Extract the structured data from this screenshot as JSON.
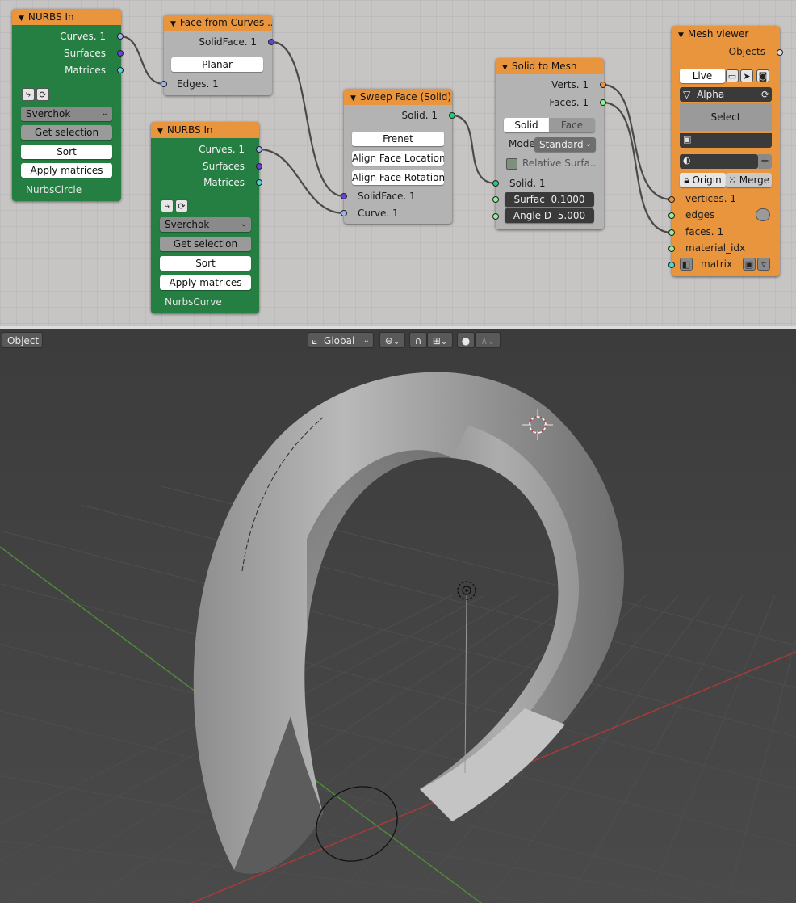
{
  "node_editor": {
    "nurbs_in_1": {
      "title": "NURBS In",
      "outputs": [
        "Curves. 1",
        "Surfaces",
        "Matrices"
      ],
      "implementation": "Sverchok",
      "get_selection_label": "Get selection",
      "sort_label": "Sort",
      "apply_matrices_label": "Apply matrices",
      "object_name": "NurbsCircle"
    },
    "face_from_curves": {
      "title": "Face from Curves ..",
      "output": "SolidFace. 1",
      "mode_button": "Planar",
      "input": "Edges. 1"
    },
    "nurbs_in_2": {
      "title": "NURBS In",
      "outputs": [
        "Curves. 1",
        "Surfaces",
        "Matrices"
      ],
      "implementation": "Sverchok",
      "get_selection_label": "Get selection",
      "sort_label": "Sort",
      "apply_matrices_label": "Apply matrices",
      "object_name": "NurbsCurve"
    },
    "sweep_face": {
      "title": "Sweep Face (Solid)",
      "output": "Solid. 1",
      "buttons": [
        "Frenet",
        "Align Face Location",
        "Align Face Rotation"
      ],
      "inputs": [
        "SolidFace. 1",
        "Curve. 1"
      ]
    },
    "solid_to_mesh": {
      "title": "Solid to Mesh",
      "outputs": [
        "Verts. 1",
        "Faces. 1"
      ],
      "tabs": [
        "Solid",
        "Face"
      ],
      "mode_label": "Mode",
      "mode_value": "Standard",
      "relative_label": "Relative Surfa..",
      "input_solid": "Solid. 1",
      "surface_field": {
        "label": "Surfac",
        "value": "0.1000"
      },
      "angle_field": {
        "label": "Angle D",
        "value": "5.000"
      }
    },
    "mesh_viewer": {
      "title": "Mesh viewer",
      "objects_label": "Objects",
      "live_label": "Live",
      "material_name": "Alpha",
      "select_label": "Select",
      "origin_label": "Origin",
      "merge_label": "Merge",
      "inputs": [
        "vertices. 1",
        "edges",
        "faces. 1",
        "material_idx",
        "matrix"
      ]
    }
  },
  "viewport": {
    "mode_label": "Object",
    "orientation_label": "Global"
  },
  "colors": {
    "node_header": "#e8953d",
    "nurbs_node": "#257f43",
    "socket_vertices": "#e8953d",
    "socket_curves": "#9fb3f0",
    "socket_surfaces": "#6a3fe0",
    "socket_matrices": "#4fd2d6",
    "socket_solid": "#2dc77a",
    "socket_numeric": "#8ef08e"
  }
}
